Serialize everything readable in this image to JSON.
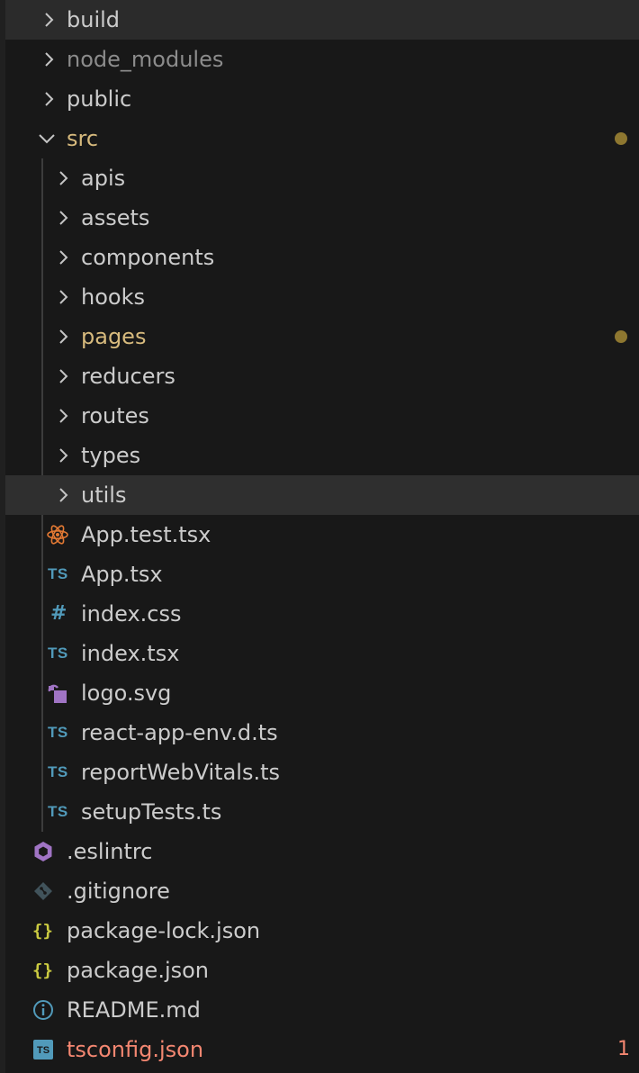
{
  "explorer": {
    "items": [
      {
        "label": "build",
        "kind": "folder",
        "expanded": false,
        "status": "normal",
        "icon": "chevron-right-icon"
      },
      {
        "label": "node_modules",
        "kind": "folder",
        "expanded": false,
        "status": "ignored",
        "icon": "chevron-right-icon"
      },
      {
        "label": "public",
        "kind": "folder",
        "expanded": false,
        "status": "normal",
        "icon": "chevron-right-icon"
      },
      {
        "label": "src",
        "kind": "folder",
        "expanded": true,
        "status": "modified",
        "icon": "chevron-down-icon"
      },
      {
        "label": "apis",
        "kind": "folder",
        "expanded": false,
        "status": "normal",
        "icon": "chevron-right-icon"
      },
      {
        "label": "assets",
        "kind": "folder",
        "expanded": false,
        "status": "normal",
        "icon": "chevron-right-icon"
      },
      {
        "label": "components",
        "kind": "folder",
        "expanded": false,
        "status": "normal",
        "icon": "chevron-right-icon"
      },
      {
        "label": "hooks",
        "kind": "folder",
        "expanded": false,
        "status": "normal",
        "icon": "chevron-right-icon"
      },
      {
        "label": "pages",
        "kind": "folder",
        "expanded": false,
        "status": "modified",
        "icon": "chevron-right-icon"
      },
      {
        "label": "reducers",
        "kind": "folder",
        "expanded": false,
        "status": "normal",
        "icon": "chevron-right-icon"
      },
      {
        "label": "routes",
        "kind": "folder",
        "expanded": false,
        "status": "normal",
        "icon": "chevron-right-icon"
      },
      {
        "label": "types",
        "kind": "folder",
        "expanded": false,
        "status": "normal",
        "icon": "chevron-right-icon"
      },
      {
        "label": "utils",
        "kind": "folder",
        "expanded": false,
        "status": "normal",
        "icon": "chevron-right-icon"
      },
      {
        "label": "App.test.tsx",
        "kind": "file",
        "status": "normal",
        "icon": "react-icon"
      },
      {
        "label": "App.tsx",
        "kind": "file",
        "status": "normal",
        "icon": "typescript-icon",
        "icon_text": "TS"
      },
      {
        "label": "index.css",
        "kind": "file",
        "status": "normal",
        "icon": "css-hash-icon",
        "icon_text": "#"
      },
      {
        "label": "index.tsx",
        "kind": "file",
        "status": "normal",
        "icon": "typescript-icon",
        "icon_text": "TS"
      },
      {
        "label": "logo.svg",
        "kind": "file",
        "status": "normal",
        "icon": "svg-image-icon"
      },
      {
        "label": "react-app-env.d.ts",
        "kind": "file",
        "status": "normal",
        "icon": "typescript-icon",
        "icon_text": "TS"
      },
      {
        "label": "reportWebVitals.ts",
        "kind": "file",
        "status": "normal",
        "icon": "typescript-icon",
        "icon_text": "TS"
      },
      {
        "label": "setupTests.ts",
        "kind": "file",
        "status": "normal",
        "icon": "typescript-icon",
        "icon_text": "TS"
      },
      {
        "label": ".eslintrc",
        "kind": "file",
        "status": "normal",
        "icon": "eslint-icon"
      },
      {
        "label": ".gitignore",
        "kind": "file",
        "status": "normal",
        "icon": "git-icon"
      },
      {
        "label": "package-lock.json",
        "kind": "file",
        "status": "normal",
        "icon": "json-braces-icon",
        "icon_text": "{}"
      },
      {
        "label": "package.json",
        "kind": "file",
        "status": "normal",
        "icon": "json-braces-icon",
        "icon_text": "{}"
      },
      {
        "label": "README.md",
        "kind": "file",
        "status": "normal",
        "icon": "info-icon"
      },
      {
        "label": "tsconfig.json",
        "kind": "file",
        "status": "error",
        "icon": "tsconfig-icon",
        "icon_text": "TS",
        "badge": "1"
      }
    ]
  },
  "colors": {
    "background": "#181818",
    "text": "#cccccc",
    "ignored": "#8c8c8c",
    "modified": "#d7ba7d",
    "error": "#f48771",
    "typescript": "#519aba",
    "json": "#cbcb41",
    "eslint": "#a074c4"
  }
}
